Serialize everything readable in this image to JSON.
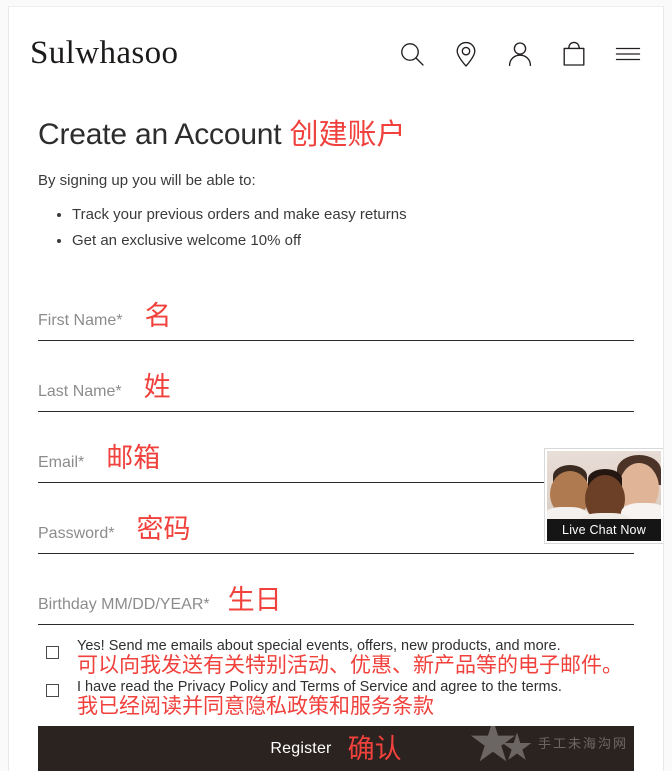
{
  "header": {
    "brand": "Sulwhasoo",
    "icons": [
      {
        "name": "search-icon",
        "label": "Search"
      },
      {
        "name": "store-locator-icon",
        "label": "Store Locator"
      },
      {
        "name": "account-icon",
        "label": "Account"
      },
      {
        "name": "shopping-bag-icon",
        "label": "Shopping Bag"
      },
      {
        "name": "menu-icon",
        "label": "Menu"
      }
    ]
  },
  "main": {
    "title_en": "Create an Account",
    "title_cn": "创建账户",
    "intro": "By signing up you will be able to:",
    "benefits": [
      "Track your previous orders and make easy returns",
      "Get an exclusive welcome 10% off"
    ],
    "fields": [
      {
        "label": "First Name*",
        "cn": "名",
        "value": "",
        "placeholder": "First Name*"
      },
      {
        "label": "Last Name*",
        "cn": "姓",
        "value": "",
        "placeholder": "Last Name*"
      },
      {
        "label": "Email*",
        "cn": "邮箱",
        "value": "",
        "placeholder": "Email*"
      },
      {
        "label": "Password*",
        "cn": "密码",
        "value": "",
        "placeholder": "Password*"
      },
      {
        "label": "Birthday MM/DD/YEAR*",
        "cn": "生日",
        "value": "",
        "placeholder": "Birthday MM/DD/YEAR*"
      }
    ],
    "consents": [
      {
        "en": "Yes! Send me emails about special events, offers, new products, and more.",
        "cn": "可以向我发送有关特别活动、优惠、新产品等的电子邮件。",
        "checked": false
      },
      {
        "en": "I have read the Privacy Policy and Terms of Service and agree to the terms.",
        "cn": "我已经阅读并同意隐私政策和服务条款",
        "checked": false
      }
    ],
    "submit": {
      "label_en": "Register",
      "label_cn": "确认"
    }
  },
  "live_chat": {
    "caption": "Live Chat Now"
  },
  "watermark": {
    "text": "手工未海沟网"
  },
  "colors": {
    "accent_red": "#f0413c",
    "button_dark": "#2b2320",
    "text_dark": "#2d2d2d",
    "label_gray": "#8c8c8c",
    "rule": "#2b2b2b"
  }
}
